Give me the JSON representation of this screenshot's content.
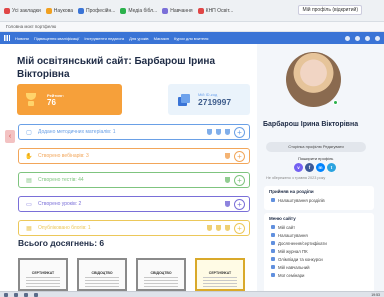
{
  "browser": {
    "bookmarks": [
      "Усі закладки",
      "Наукова",
      "Професійн...",
      "Медіа бібл...",
      "Навчання",
      "КНП Освіт..."
    ],
    "profile_label": "Мій профіль (відкритий)",
    "tab_hint": "Головна моєї портфелю"
  },
  "nav": {
    "items": [
      "Новини",
      "Підвищення кваліфікації",
      "Інструменти педагога",
      "Для уроків",
      "Магазин",
      "Курси для вчителя"
    ]
  },
  "main": {
    "title": "Мій освітянський сайт: Барбарош Ірина Вікторівна",
    "rating": {
      "label": "Рейтинг:",
      "value": "76"
    },
    "id_card": {
      "label": "Мій ID-код",
      "value": "2719997"
    },
    "achievements": [
      {
        "label": "Додано методичних матеріалів: 1",
        "color": "#6aa0e6",
        "icon": "document-icon",
        "trophies": 3
      },
      {
        "label": "Створено вебінарів: 3",
        "color": "#f2a65a",
        "icon": "hand-icon",
        "trophies": 1
      },
      {
        "label": "Створено тестів: 44",
        "color": "#7fc47f",
        "icon": "test-icon",
        "trophies": 1
      },
      {
        "label": "Створено уроків: 2",
        "color": "#7a6fd8",
        "icon": "lesson-icon",
        "trophies": 1
      },
      {
        "label": "Опубліковано блогів: 1",
        "color": "#ecc85a",
        "icon": "blog-icon",
        "trophies": 3
      }
    ],
    "all_achievements_title": "Всього досягнень: 6",
    "certificates": [
      "СЕРТИФІКАТ",
      "СВІДОЦТВО",
      "СВІДОЦТВО",
      "СЕРТИФІКАТ"
    ]
  },
  "sidebar": {
    "name": "Барбарош Ірина Вікторівна",
    "edit_button": "Сторінка профілю Редагувати",
    "share_label": "Поширити профіль",
    "socials": [
      {
        "icon": "viber-icon",
        "glyph": "v",
        "color": "#7360f2"
      },
      {
        "icon": "facebook-icon",
        "glyph": "f",
        "color": "#3b5998"
      },
      {
        "icon": "messenger-icon",
        "glyph": "m",
        "color": "#0084ff"
      },
      {
        "icon": "telegram-icon",
        "glyph": "t",
        "color": "#2aa3df"
      }
    ],
    "online_text": "Не збережено з травня 2023 року",
    "box1": {
      "title": "Прийняв на роздіпи",
      "items": [
        "Налаштування розділів"
      ]
    },
    "box2": {
      "title": "Меню сайту",
      "items": [
        "Мій сайт",
        "Налаштування",
        "Досягнення/сертифікати",
        "Мій журнал ПК",
        "Олімпіади та конкурси",
        "Мій навчальний",
        "Мої семінари"
      ]
    }
  },
  "taskbar": {
    "clock": "19:53"
  }
}
